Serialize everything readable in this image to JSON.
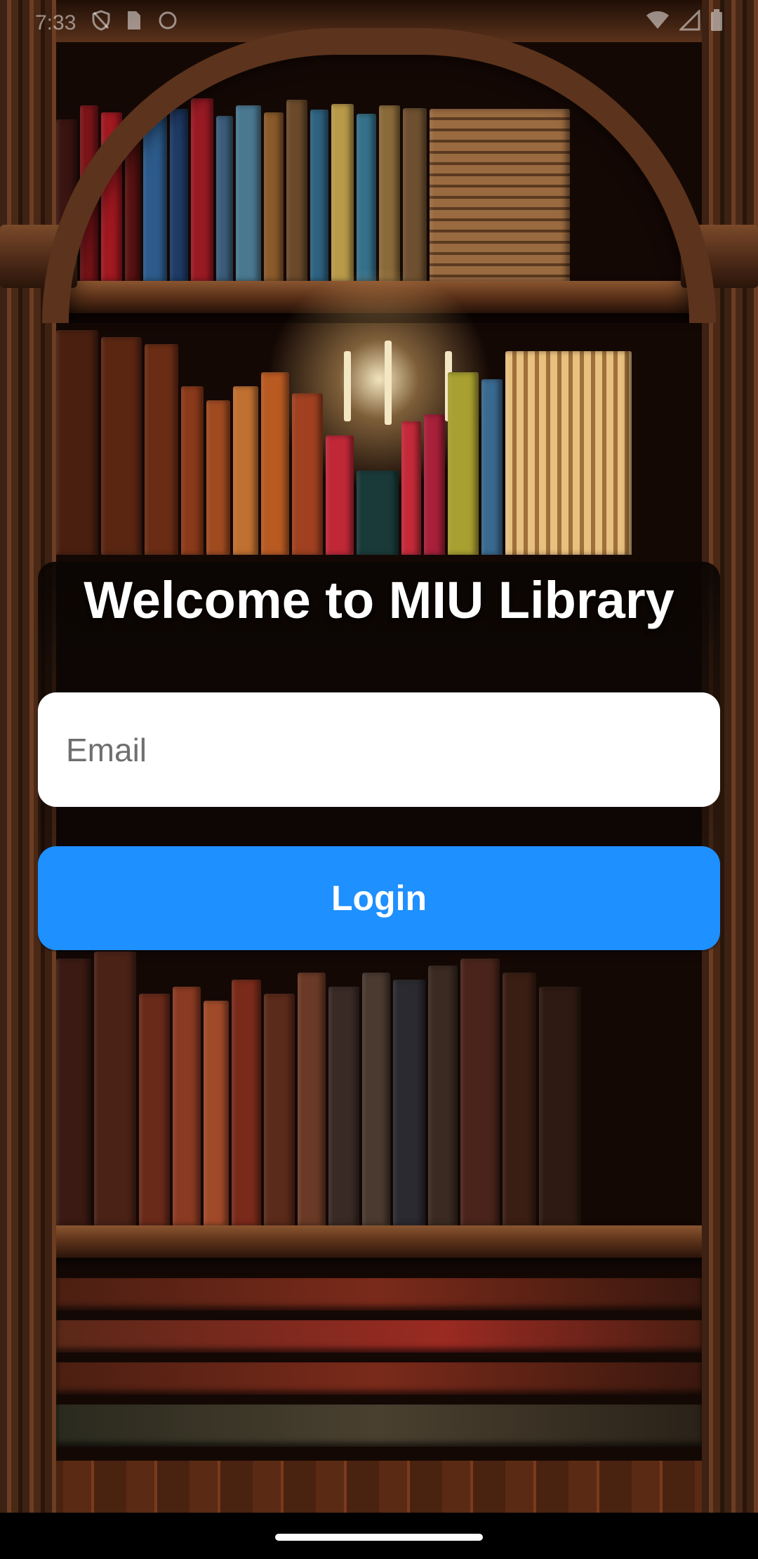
{
  "status_bar": {
    "time": "7:33"
  },
  "login": {
    "title": "Welcome to MIU Library",
    "email_placeholder": "Email",
    "email_value": "",
    "button_label": "Login"
  },
  "colors": {
    "accent": "#1E90FF",
    "input_bg": "#FFFFFF",
    "title_text": "#FFFFFF",
    "nav_bar": "#000000"
  },
  "icons": {
    "status_left": [
      "shield-icon",
      "sim-card-icon",
      "circle-icon"
    ],
    "status_right": [
      "wifi-icon",
      "signal-icon",
      "battery-icon"
    ]
  }
}
